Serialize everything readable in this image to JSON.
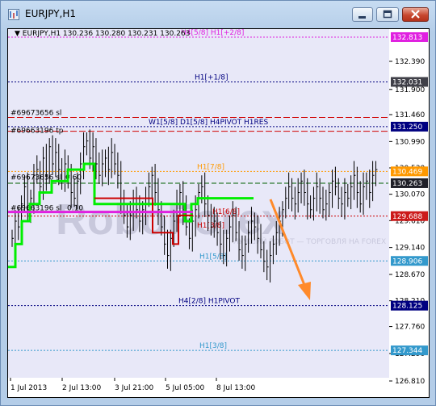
{
  "window": {
    "title": "EURJPY,H1",
    "minimize_label": "minimize",
    "restore_label": "restore",
    "close_label": "close"
  },
  "header": {
    "symbol_line": "EURJPY,H1  130.236 130.280 130.231 130.263"
  },
  "colors": {
    "background": "#e8e8f8",
    "grid": "#8a8ac0",
    "price_axis_text": "#000000",
    "magenta": "#e020e0",
    "navy": "#000080",
    "red": "#d00000",
    "orange": "#ff9900",
    "green": "#00ee00",
    "dark_red": "#cc0000",
    "light_blue": "#3399cc",
    "dark_green": "#006000",
    "arrow": "#ff8a2a",
    "watermark": "#c8c8dc"
  },
  "watermark": {
    "text": "RoboForex",
    "subtitle": "ЛУЧШИЙ РОБОТ — ТОРГОВЛЯ НА FOREX"
  },
  "price_axis": {
    "ticks": [
      "132.390",
      "131.900",
      "131.460",
      "130.990",
      "130.530",
      "130.070",
      "129.610",
      "129.140",
      "128.670",
      "128.210",
      "127.760",
      "127.290",
      "126.810"
    ]
  },
  "levels": [
    {
      "label": "H4[5/8] H1[+2/8]",
      "price": "132.813",
      "tag_bg": "#e020e0",
      "tag_fg": "#ffffff"
    },
    {
      "label": "H1[+1/8]",
      "price": "132.031",
      "tag_bg": "#404048",
      "tag_fg": "#ffffff"
    },
    {
      "label": "W1[5/8] D1[5/8] H4PIVOT H1RES",
      "price": "131.250",
      "tag_bg": "#000080",
      "tag_fg": "#ffffff"
    },
    {
      "label": "H1[7/8]",
      "price": "130.469",
      "tag_bg": "#ff9900",
      "tag_fg": "#ffffff"
    },
    {
      "label": "",
      "price": "130.263",
      "tag_bg": "#202028",
      "tag_fg": "#ffffff"
    },
    {
      "label": "H1[6/8]",
      "price": "129.688",
      "tag_bg": "#cc1a1a",
      "tag_fg": "#ffffff"
    },
    {
      "label": "H1[5/8]",
      "price": "128.906",
      "tag_bg": "#3399cc",
      "tag_fg": "#ffffff"
    },
    {
      "label": "H4[2/8] H1PIVOT",
      "price": "128.125",
      "tag_bg": "#000080",
      "tag_fg": "#ffffff"
    },
    {
      "label": "H1[3/8]",
      "price": "127.344",
      "tag_bg": "#3399cc",
      "tag_fg": "#ffffff"
    }
  ],
  "order_labels": {
    "sl1": "#69673656 sl",
    "tp1": "#69663196 tp",
    "sl2": "#69673656 sl",
    "sl2_value": "0.60",
    "sl3": "#69663196 sl",
    "sl3_value": "0.10",
    "h1_38": "H1[3/8]"
  },
  "time_axis": {
    "labels": [
      "1 Jul 2013",
      "2 Jul 13:00",
      "3 Jul 21:00",
      "5 Jul 05:00",
      "8 Jul 13:00"
    ]
  }
}
